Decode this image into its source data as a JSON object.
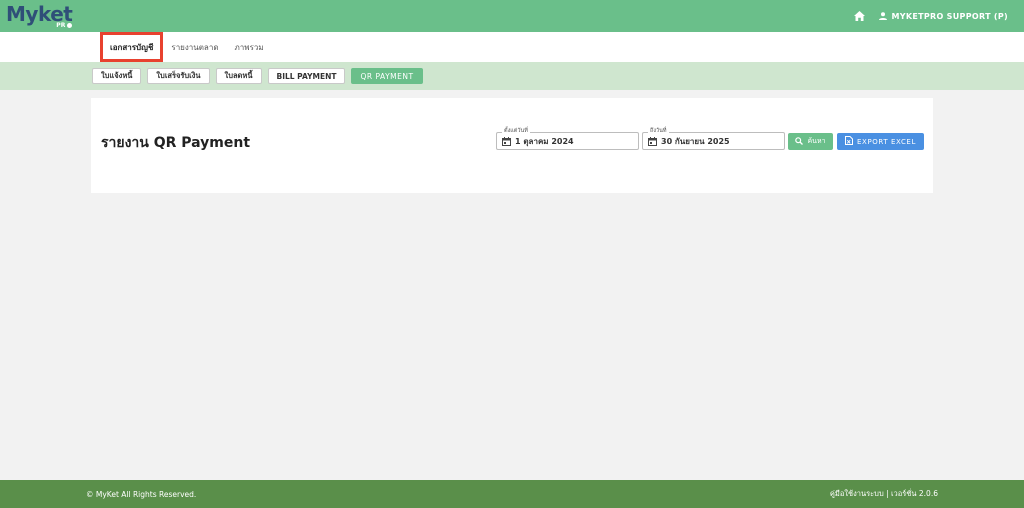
{
  "brand": {
    "name": "Myket",
    "sub": "PR"
  },
  "topbar": {
    "user_label": "MYKETPRO SUPPORT (P)"
  },
  "tabs": [
    {
      "label": "เอกสารบัญชี",
      "active": true
    },
    {
      "label": "รายงานตลาด",
      "active": false
    },
    {
      "label": "ภาพรวม",
      "active": false
    }
  ],
  "subnav": [
    {
      "label": "ใบแจ้งหนี้",
      "active": false
    },
    {
      "label": "ใบเสร็จรับเงิน",
      "active": false
    },
    {
      "label": "ใบลดหนี้",
      "active": false
    },
    {
      "label": "BILL PAYMENT",
      "active": false
    },
    {
      "label": "QR PAYMENT",
      "active": true
    }
  ],
  "main": {
    "title": "รายงาน QR Payment",
    "date_from": {
      "label": "ตั้งแต่วันที่",
      "value": "1 ตุลาคม 2024"
    },
    "date_to": {
      "label": "ถึงวันที่",
      "value": "30 กันยายน 2025"
    },
    "search_label": "ค้นหา",
    "export_label": "EXPORT EXCEL"
  },
  "footer": {
    "copyright": "© MyKet All Rights Reserved.",
    "right": "คู่มือใช้งานระบบ | เวอร์ชั่น 2.0.6"
  },
  "colors": {
    "topbar": "#6abf8a",
    "subnav": "#cfe6cf",
    "footer": "#5a8f4a",
    "search": "#6abf8a",
    "export": "#4a90e2",
    "highlight": "#e8412f"
  }
}
